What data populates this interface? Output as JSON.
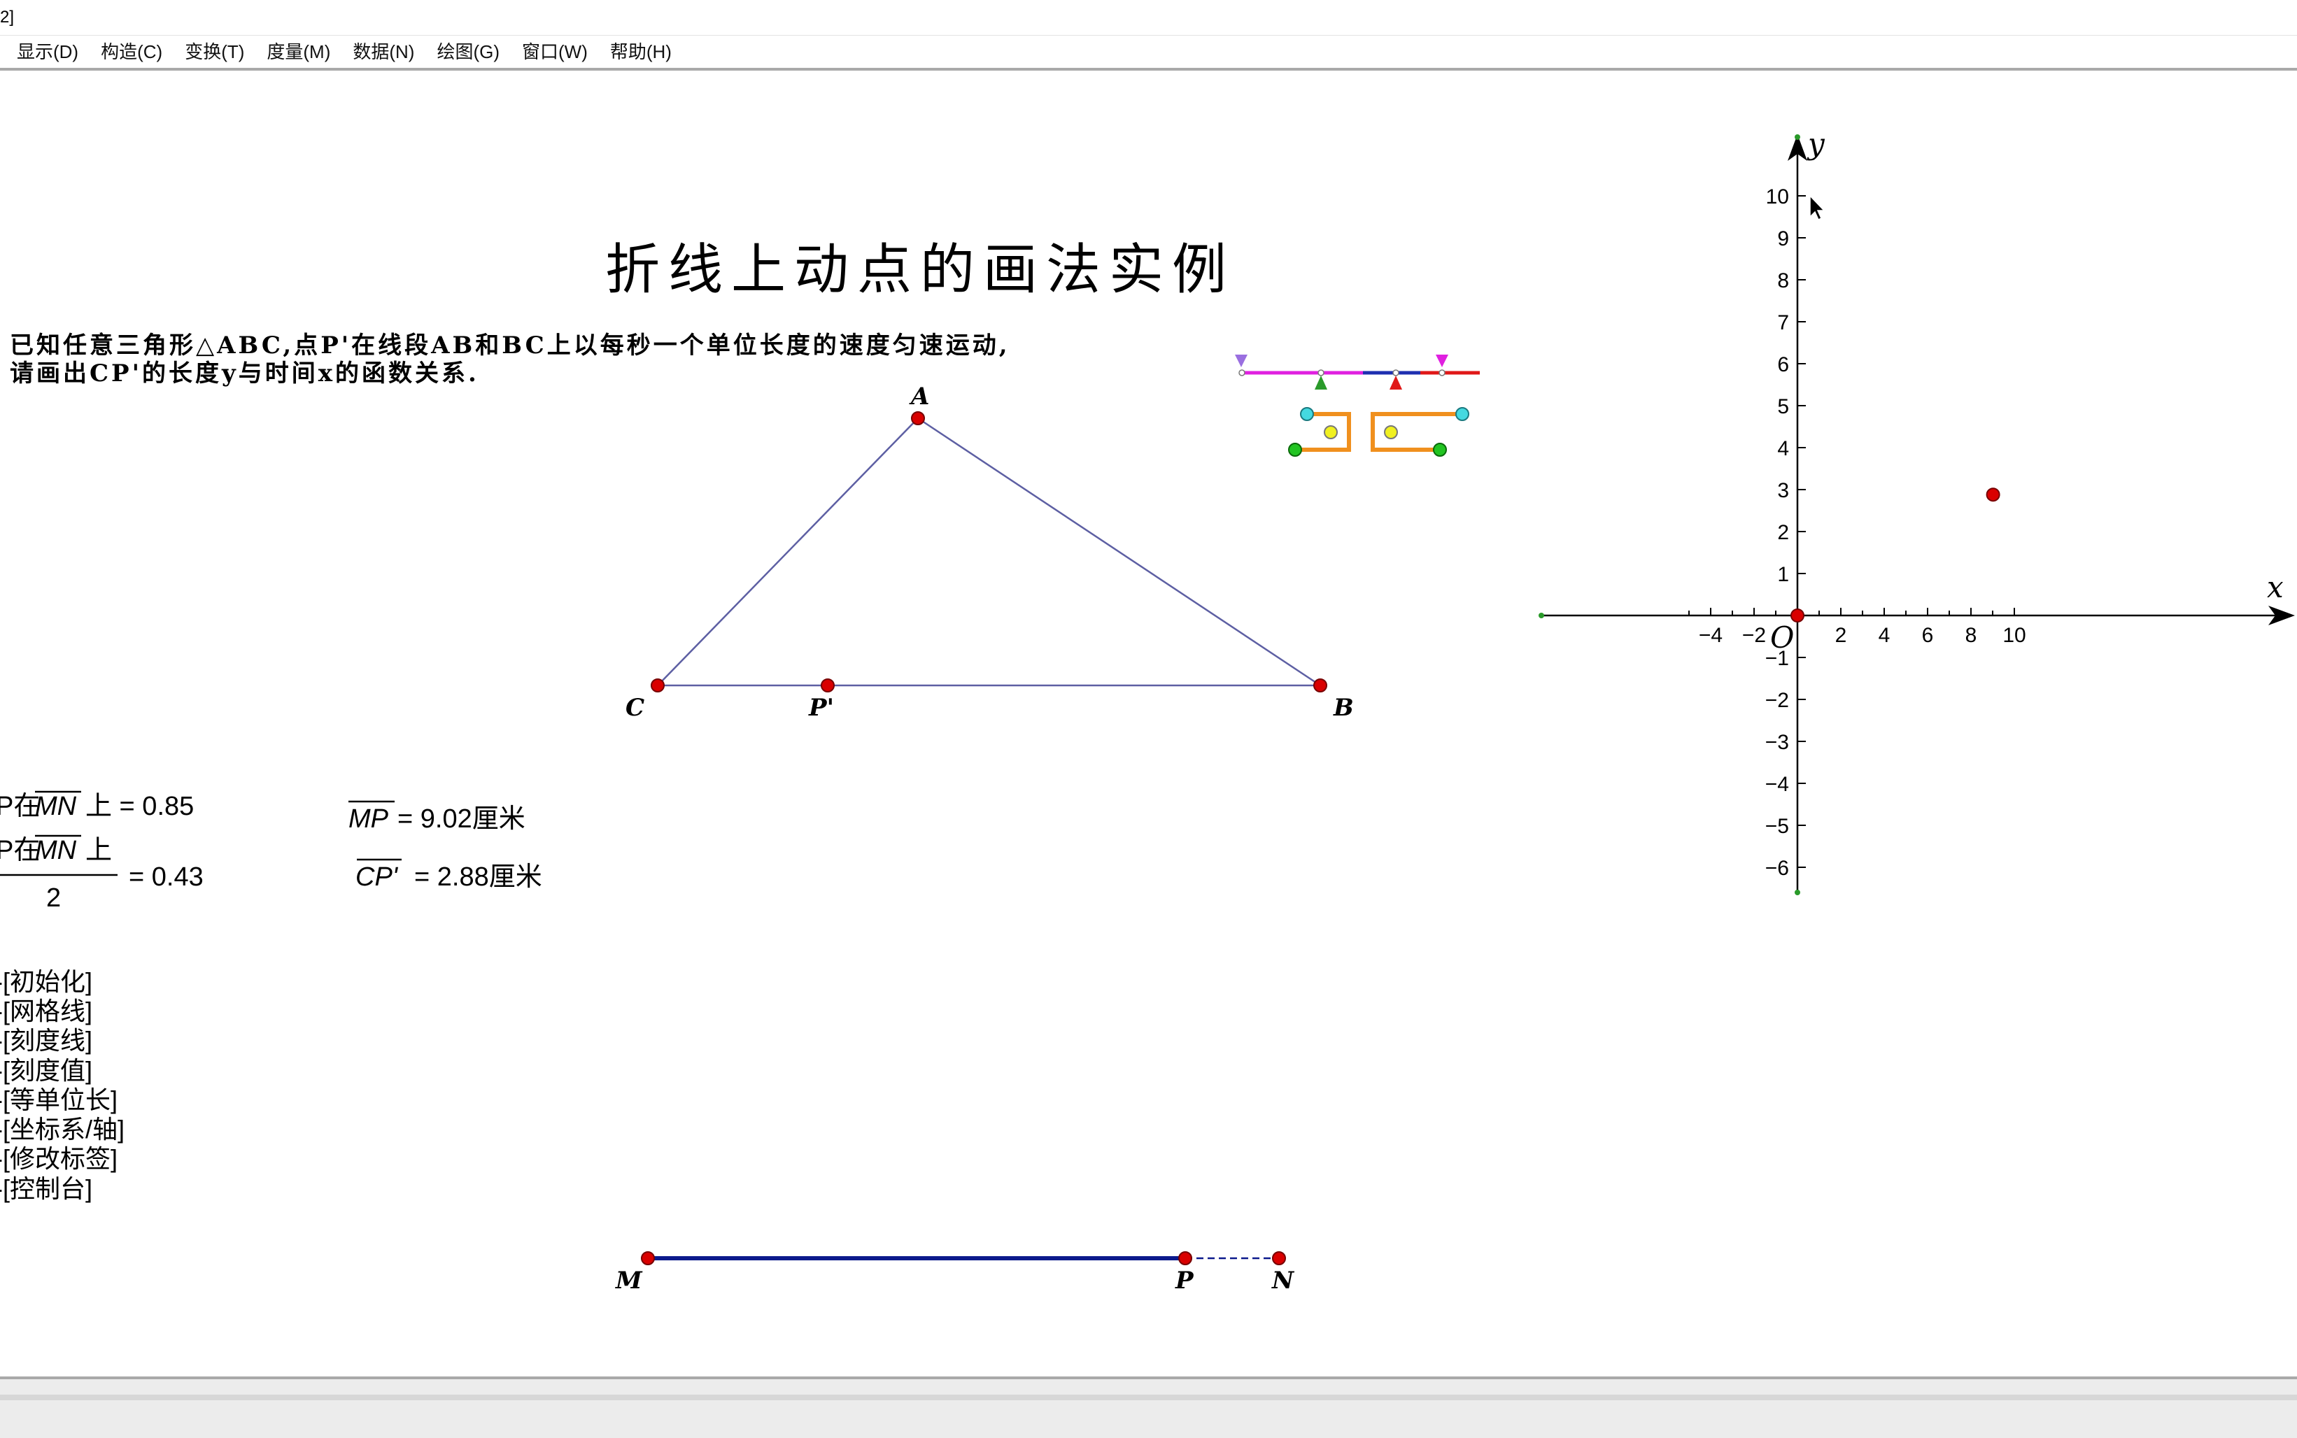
{
  "window": {
    "title_fragment": "2]"
  },
  "menu": [
    {
      "label": "显示(D)"
    },
    {
      "label": "构造(C)"
    },
    {
      "label": "变换(T)"
    },
    {
      "label": "度量(M)"
    },
    {
      "label": "数据(N)"
    },
    {
      "label": "绘图(G)"
    },
    {
      "label": "窗口(W)"
    },
    {
      "label": "帮助(H)"
    }
  ],
  "document": {
    "title": "折线上动点的画法实例",
    "problem_line1": "已知任意三角形△ABC,点P'在线段AB和BC上以每秒一个单位长度的速度匀速运动,",
    "problem_line2": "请画出CP'的长度y与时间x的函数关系."
  },
  "triangle_labels": {
    "A": "A",
    "B": "B",
    "C": "C",
    "P": "P'"
  },
  "segment_labels": {
    "M": "M",
    "P": "P",
    "N": "N"
  },
  "measurements": {
    "m1_prefix": "P在",
    "m1_seg": "MN",
    "m1_suffix": "上 = 0.85",
    "m2_prefix": "P在",
    "m2_seg": "MN",
    "m2_suffix": "上",
    "m2_den": "2",
    "m2_value": "= 0.43",
    "mp_seg": "MP",
    "mp_value": "= 9.02厘米",
    "cp_seg": "CP'",
    "cp_value": "= 2.88厘米"
  },
  "buttons": [
    {
      "label": "-[初始化]"
    },
    {
      "label": "-[网格线]"
    },
    {
      "label": "-[刻度线]"
    },
    {
      "label": "-[刻度值]"
    },
    {
      "label": "-[等单位长]"
    },
    {
      "label": "-[坐标系/轴]"
    },
    {
      "label": "-[修改标签]"
    },
    {
      "label": "-[控制台]"
    }
  ],
  "coordinate_system": {
    "x_axis_label": "x",
    "y_axis_label": "y",
    "origin_label": "O",
    "x_tick_labels": [
      "−4",
      "−2",
      "2",
      "4",
      "6",
      "8",
      "10"
    ],
    "y_tick_labels": [
      "10",
      "9",
      "8",
      "7",
      "6",
      "5",
      "4",
      "3",
      "2",
      "1",
      "−1",
      "−2",
      "−3",
      "−4",
      "−5",
      "−6"
    ],
    "plotted_point": {
      "x": 9.02,
      "y": 2.88
    },
    "colors": {
      "point": "#d90000",
      "axis": "#000000",
      "triangle": "#5d5fa3",
      "segment": "#0c1a8c"
    }
  }
}
